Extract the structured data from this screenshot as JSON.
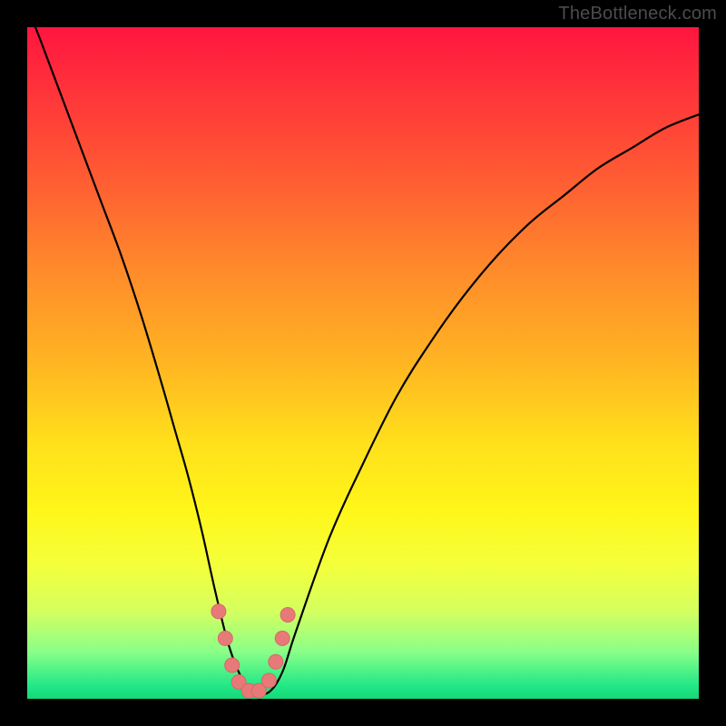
{
  "watermark": {
    "text": "TheBottleneck.com"
  },
  "colors": {
    "frame": "#000000",
    "curve": "#000000",
    "marker_fill": "#e77a79",
    "marker_stroke": "#d86766",
    "gradient_stops": [
      "#ff153f",
      "#ffe01b",
      "#22e887"
    ]
  },
  "chart_data": {
    "type": "line",
    "title": "",
    "xlabel": "",
    "ylabel": "",
    "xlim": [
      0,
      100
    ],
    "ylim": [
      0,
      100
    ],
    "x": [
      0,
      2,
      5,
      8,
      11,
      14,
      17,
      20,
      22,
      24,
      26,
      28,
      30,
      32,
      34,
      36,
      38,
      40,
      45,
      50,
      55,
      60,
      65,
      70,
      75,
      80,
      85,
      90,
      95,
      100
    ],
    "values": [
      103,
      98,
      90,
      82,
      74,
      66,
      57,
      47,
      40,
      33,
      25,
      16,
      8,
      3,
      1,
      1,
      4,
      10,
      24,
      35,
      45,
      53,
      60,
      66,
      71,
      75,
      79,
      82,
      85,
      87
    ],
    "series": [
      {
        "name": "bottleneck-curve",
        "x": [
          0,
          2,
          5,
          8,
          11,
          14,
          17,
          20,
          22,
          24,
          26,
          28,
          30,
          32,
          34,
          36,
          38,
          40,
          45,
          50,
          55,
          60,
          65,
          70,
          75,
          80,
          85,
          90,
          95,
          100
        ],
        "y": [
          103,
          98,
          90,
          82,
          74,
          66,
          57,
          47,
          40,
          33,
          25,
          16,
          8,
          3,
          1,
          1,
          4,
          10,
          24,
          35,
          45,
          53,
          60,
          66,
          71,
          75,
          79,
          82,
          85,
          87
        ]
      }
    ],
    "markers": {
      "name": "highlight-dots",
      "points": [
        {
          "x": 28.5,
          "y": 13.0
        },
        {
          "x": 29.5,
          "y": 9.0
        },
        {
          "x": 30.5,
          "y": 5.0
        },
        {
          "x": 31.5,
          "y": 2.5
        },
        {
          "x": 33.0,
          "y": 1.2
        },
        {
          "x": 34.5,
          "y": 1.2
        },
        {
          "x": 36.0,
          "y": 2.7
        },
        {
          "x": 37.0,
          "y": 5.5
        },
        {
          "x": 38.0,
          "y": 9.0
        },
        {
          "x": 38.8,
          "y": 12.5
        }
      ],
      "radius": 8
    },
    "grid": false,
    "legend": false,
    "axes_visible": false,
    "background": "vertical-gradient-heatmap"
  }
}
